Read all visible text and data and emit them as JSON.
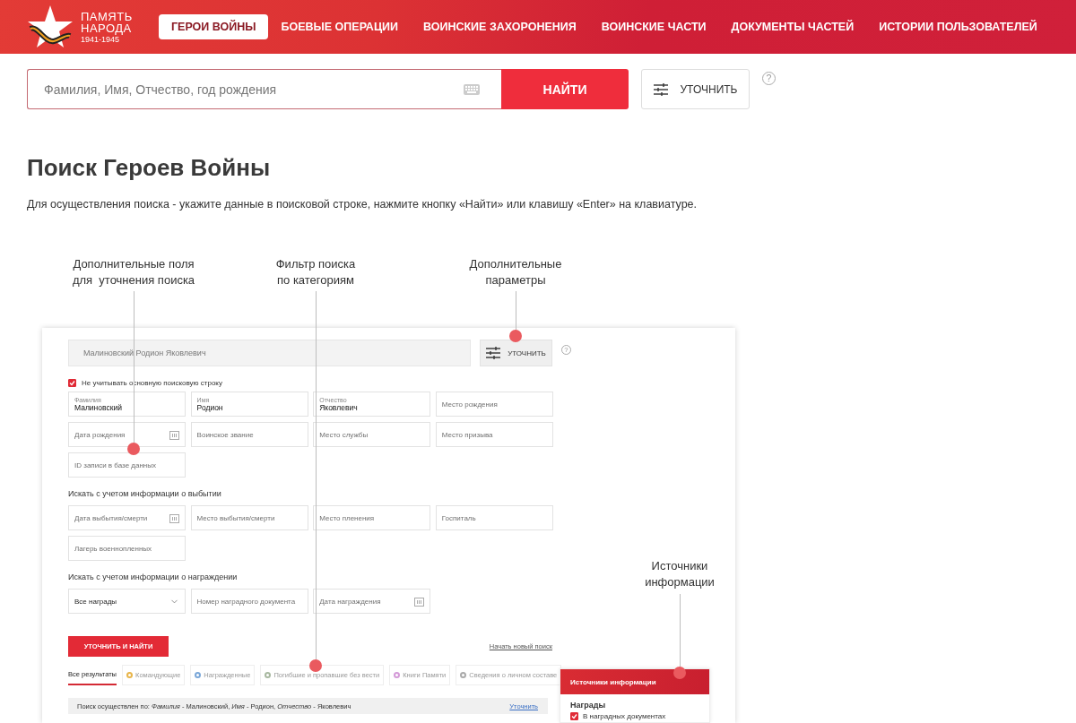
{
  "header": {
    "logo": {
      "line1": "ПАМЯТЬ",
      "line2": "НАРОДА",
      "years": "1941-1945"
    },
    "nav": [
      {
        "label": "ГЕРОИ ВОЙНЫ",
        "selected": true
      },
      {
        "label": "БОЕВЫЕ ОПЕРАЦИИ",
        "selected": false
      },
      {
        "label": "ВОИНСКИЕ ЗАХОРОНЕНИЯ",
        "selected": false
      },
      {
        "label": "ВОИНСКИЕ ЧАСТИ",
        "selected": false
      },
      {
        "label": "ДОКУМЕНТЫ ЧАСТЕЙ",
        "selected": false
      },
      {
        "label": "ИСТОРИИ ПОЛЬЗОВАТЕЛЕЙ",
        "selected": false
      }
    ]
  },
  "search": {
    "placeholder": "Фамилия, Имя, Отчество, год рождения",
    "button": "НАЙТИ",
    "refine": "УТОЧНИТЬ",
    "help": "?"
  },
  "title": "Поиск Героев Войны",
  "description": "Для осуществления поиска - укажите данные в поисковой строке, нажмите кнопку «Найти» или клавишу «Enter» на клавиатуре.",
  "illustration": {
    "callouts": [
      {
        "text": "Дополнительные поля\nдля  уточнения поиска"
      },
      {
        "text": "Фильтр поиска\nпо категориям"
      },
      {
        "text": "Дополнительные\nпараметры"
      },
      {
        "text": "Источники\nинформации"
      }
    ],
    "form": {
      "query": "Малиновский Родион Яковлевич",
      "refine": "УТОЧНИТЬ",
      "help": "?",
      "ignore_main": {
        "label": "Не учитывать основную поисковую строку",
        "checked": true
      },
      "groups": [
        {
          "fields": [
            {
              "kind": "text",
              "label": "Фамилия",
              "value": "Малиновский"
            },
            {
              "kind": "text",
              "label": "Имя",
              "value": "Родион"
            },
            {
              "kind": "text",
              "label": "Отчество",
              "value": "Яковлевич"
            },
            {
              "kind": "text",
              "placeholder": "Место рождения"
            },
            {
              "kind": "date",
              "placeholder": "Дата рождения"
            },
            {
              "kind": "text",
              "placeholder": "Воинское звание"
            },
            {
              "kind": "text",
              "placeholder": "Место службы"
            },
            {
              "kind": "text",
              "placeholder": "Место призыва"
            },
            {
              "kind": "text",
              "placeholder": "ID записи в базе данных"
            }
          ]
        },
        {
          "heading": "Искать с учетом информации о выбытии",
          "fields": [
            {
              "kind": "date",
              "placeholder": "Дата выбытия/смерти"
            },
            {
              "kind": "text",
              "placeholder": "Место выбытия/смерти"
            },
            {
              "kind": "text",
              "placeholder": "Место пленения"
            },
            {
              "kind": "text",
              "placeholder": "Госпиталь"
            },
            {
              "kind": "text",
              "placeholder": "Лагерь военнопленных"
            }
          ]
        },
        {
          "heading": "Искать с учетом информации о награждении",
          "fields": [
            {
              "kind": "select",
              "value": "Все награды"
            },
            {
              "kind": "text",
              "placeholder": "Номер наградного документа"
            },
            {
              "kind": "date",
              "placeholder": "Дата награждения"
            }
          ]
        }
      ],
      "submit": "УТОЧНИТЬ И НАЙТИ",
      "reset": "Начать новый поиск",
      "tabs": [
        {
          "label": "Все результаты",
          "selected": true
        },
        {
          "label": "Командующие",
          "selected": false,
          "color": "#e8b54a"
        },
        {
          "label": "Награжденные",
          "selected": false,
          "color": "#7aa7d8"
        },
        {
          "label": "Погибшие и пропавшие без вести",
          "selected": false,
          "color": "#a8b8a0"
        },
        {
          "label": "Книги Памяти",
          "selected": false,
          "color": "#d49ad8"
        },
        {
          "label": "Сведения о личном составе",
          "selected": false,
          "color": "#aaaaaa"
        }
      ],
      "summary": {
        "text": "Поиск осуществлен по: *Фамилия* - Малиновский, *Имя* - Родион, *Отчество* - Яковлевич",
        "link": "Уточнить"
      },
      "sources": {
        "title": "Источники информации",
        "group": "Награды",
        "options": [
          {
            "label": "В наградных документах",
            "checked": true
          }
        ]
      }
    }
  }
}
